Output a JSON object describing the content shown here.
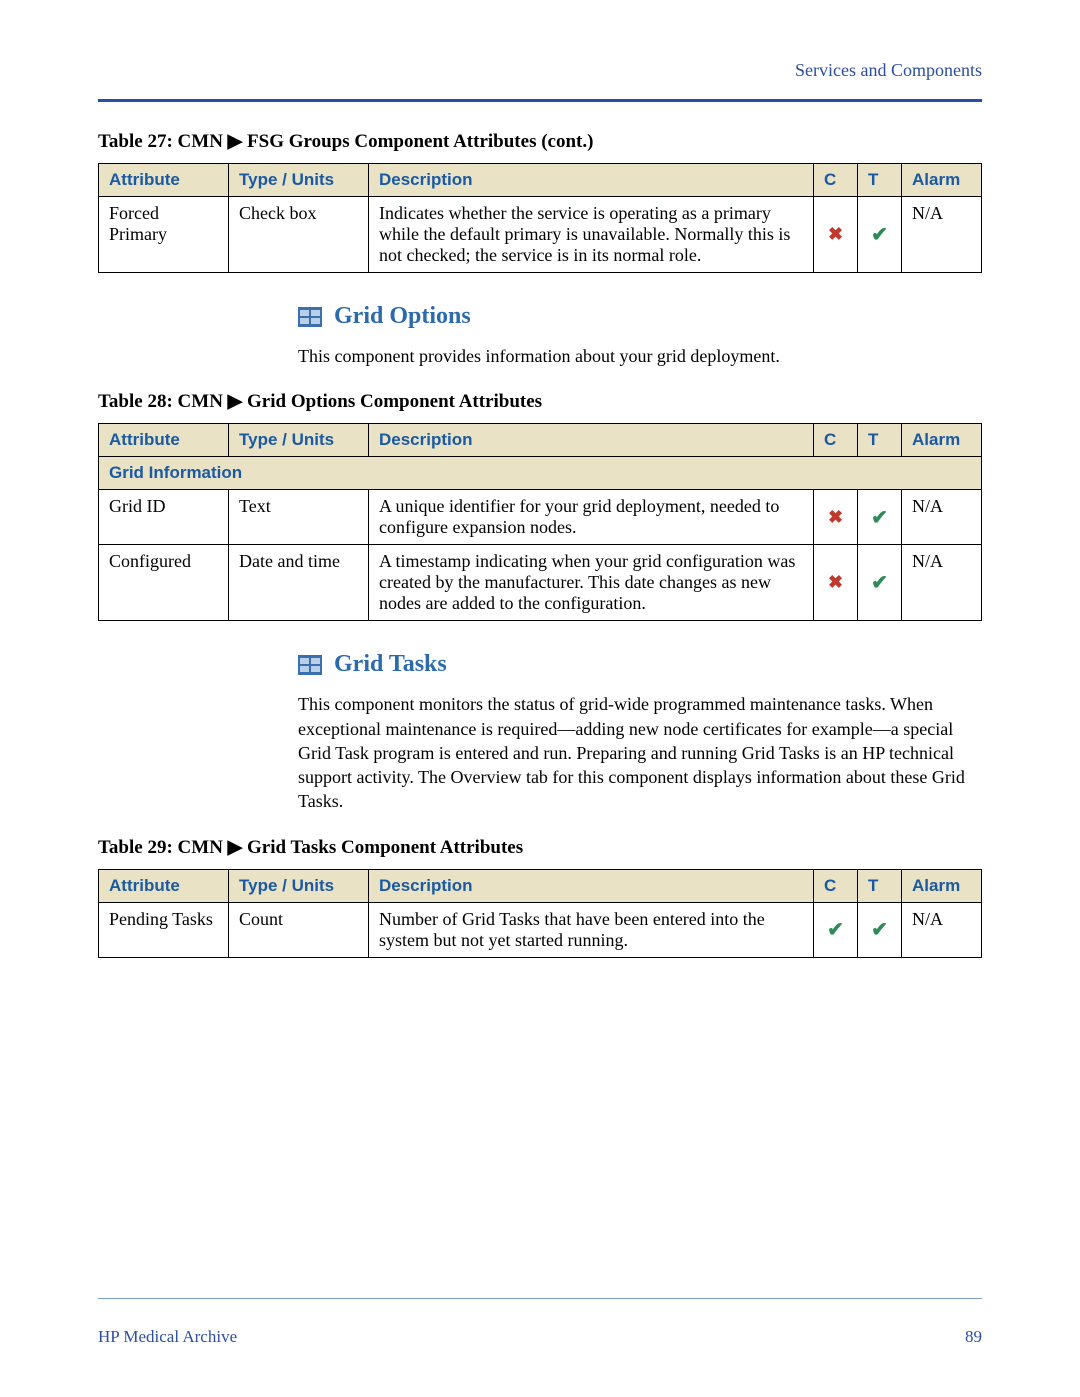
{
  "header": {
    "link": "Services and Components"
  },
  "table27": {
    "caption": "Table 27: CMN ▶ FSG Groups Component Attributes (cont.)",
    "headers": {
      "attribute": "Attribute",
      "type": "Type / Units",
      "description": "Description",
      "c": "C",
      "t": "T",
      "alarm": "Alarm"
    },
    "rows": [
      {
        "attribute": "Forced Primary",
        "type": "Check box",
        "description": "Indicates whether the service is operating as a primary while the default primary is unavailable. Normally this is not checked; the service is in its normal role.",
        "c": "cross",
        "t": "check",
        "alarm": "N/A"
      }
    ]
  },
  "gridOptions": {
    "heading": "Grid Options",
    "intro": "This component provides information about your grid deployment."
  },
  "table28": {
    "caption": "Table 28: CMN ▶ Grid Options Component Attributes",
    "headers": {
      "attribute": "Attribute",
      "type": "Type / Units",
      "description": "Description",
      "c": "C",
      "t": "T",
      "alarm": "Alarm"
    },
    "sectionLabel": "Grid Information",
    "rows": [
      {
        "attribute": "Grid ID",
        "type": "Text",
        "description": "A unique identifier for your grid deployment, needed to configure expansion nodes.",
        "c": "cross",
        "t": "check",
        "alarm": "N/A"
      },
      {
        "attribute": "Configured",
        "type": "Date and time",
        "description": "A timestamp indicating when your grid configuration was created by the manufacturer. This date changes as new nodes are added to the configuration.",
        "c": "cross",
        "t": "check",
        "alarm": "N/A"
      }
    ]
  },
  "gridTasks": {
    "heading": "Grid Tasks",
    "intro": "This component monitors the status of grid-wide programmed maintenance tasks. When exceptional maintenance is required—adding new node certificates for example—a special Grid Task program is entered and run. Preparing and running Grid Tasks is an HP technical support activity. The Overview tab for this component displays information about these Grid Tasks."
  },
  "table29": {
    "caption": "Table 29: CMN ▶ Grid Tasks Component Attributes",
    "headers": {
      "attribute": "Attribute",
      "type": "Type / Units",
      "description": "Description",
      "c": "C",
      "t": "T",
      "alarm": "Alarm"
    },
    "rows": [
      {
        "attribute": "Pending Tasks",
        "type": "Count",
        "description": "Number of Grid Tasks that have been entered into the system but not yet started running.",
        "c": "check",
        "t": "check",
        "alarm": "N/A"
      }
    ]
  },
  "footer": {
    "left": "HP Medical Archive",
    "page": "89"
  }
}
